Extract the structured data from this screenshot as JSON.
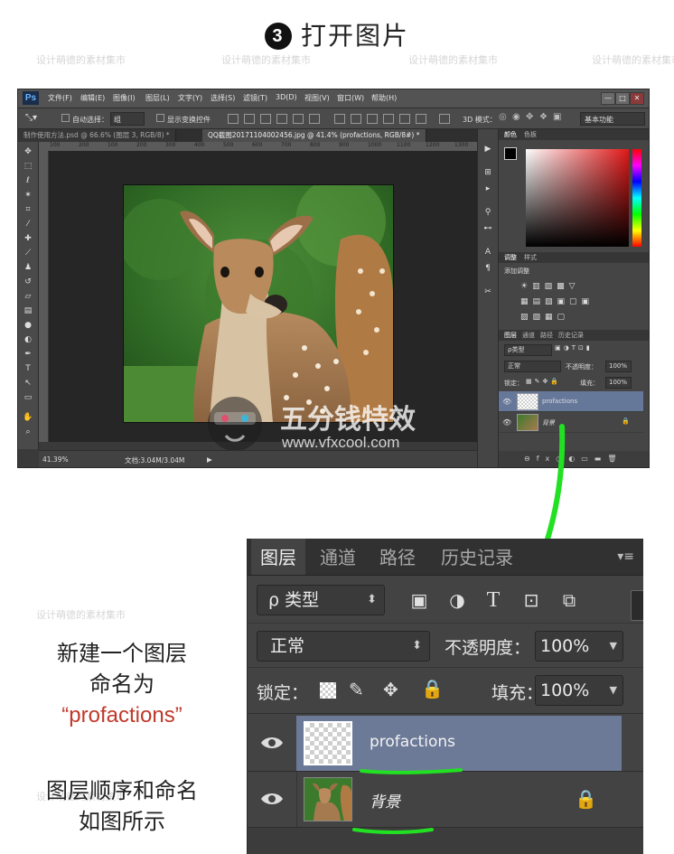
{
  "title": {
    "step_number": "3",
    "text": "打开图片"
  },
  "watermark_text": "设计萌德的素材集市",
  "ps": {
    "logo": "Ps",
    "menus": [
      "文件(F)",
      "编辑(E)",
      "图像(I)",
      "图层(L)",
      "文字(Y)",
      "选择(S)",
      "滤镜(T)",
      "3D(D)",
      "视图(V)",
      "窗口(W)",
      "帮助(H)"
    ],
    "window_buttons": [
      "—",
      "□",
      "✕"
    ],
    "options": {
      "auto_select_label": "自动选择：",
      "auto_select_value": "组",
      "show_transform_label": "显示变换控件",
      "mode_3d_label": "3D 模式：",
      "workspace": "基本功能"
    },
    "tabs": [
      {
        "label": "制作使用方法.psd @ 66.6% (图层 3, RGB/8) *",
        "active": false
      },
      {
        "label": "QQ截图20171104002456.jpg @ 41.4% (profactions, RGB/8#) *",
        "active": true
      }
    ],
    "ruler_numbers": [
      "100",
      "200",
      "100",
      "200",
      "300",
      "400",
      "500",
      "600",
      "700",
      "800",
      "900",
      "1000",
      "1100",
      "1200",
      "1300"
    ],
    "status": {
      "zoom": "41.39%",
      "doc": "文档:3.04M/3.04M"
    },
    "panels": {
      "color_tabs": [
        "颜色",
        "色板"
      ],
      "adjust_tabs": [
        "调整",
        "样式"
      ],
      "adjust_title": "添加调整",
      "layers_tabs": [
        "图层",
        "通道",
        "路径",
        "历史记录"
      ],
      "filter_type": "ρ类型",
      "blend_mode": "正常",
      "opacity_label": "不透明度：",
      "opacity_value": "100%",
      "lock_label": "锁定：",
      "fill_label": "填充：",
      "fill_value": "100%",
      "layers": [
        {
          "name": "profactions",
          "selected": true
        },
        {
          "name": "背景",
          "selected": false
        }
      ]
    }
  },
  "logo_watermark": {
    "name": "五分钱特效",
    "url": "www.vfxcool.com"
  },
  "zoom_panel": {
    "tabs": [
      "图层",
      "通道",
      "路径",
      "历史记录"
    ],
    "menu_icon": "▾≡",
    "filter_type": "ρ 类型",
    "blend_mode": "正常",
    "opacity_label": "不透明度：",
    "opacity_value": "100%",
    "lock_label": "锁定：",
    "fill_label": "填充：",
    "fill_value": "100%",
    "layers": [
      {
        "name": "profactions",
        "selected": true
      },
      {
        "name": "背景",
        "selected": false
      }
    ]
  },
  "notes": {
    "line1": "新建一个图层",
    "line2": "命名为",
    "line3_open": "“",
    "line3_name": "profactions",
    "line3_close": "”",
    "line4": "图层顺序和命名",
    "line5": "如图所示"
  },
  "colors": {
    "annotation_green": "#22e022",
    "selected_layer": "#6a7a9a",
    "ps_dark": "#3a3a3a"
  }
}
